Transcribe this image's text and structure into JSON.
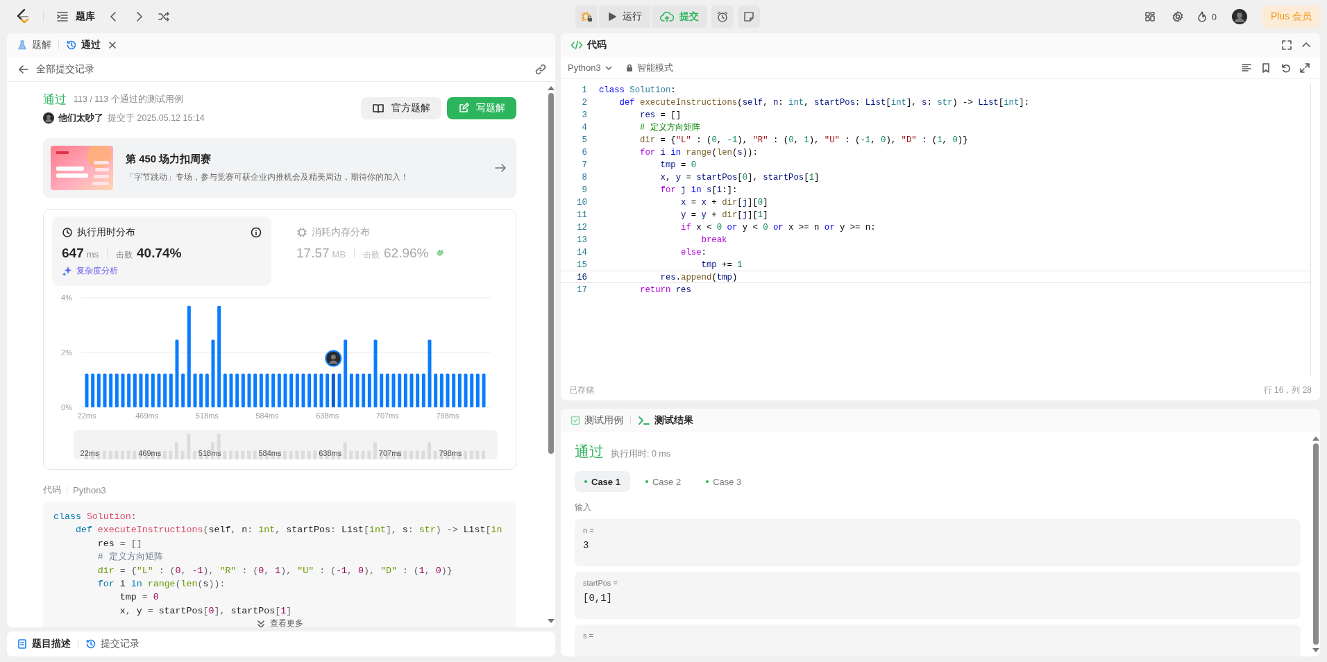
{
  "top_bar": {
    "problem_list": "题库",
    "run": "运行",
    "submit": "提交",
    "streak": "0",
    "plus": "Plus 会员"
  },
  "left_panel": {
    "tabs": [
      {
        "label": "题解",
        "selected": false,
        "closable": false
      },
      {
        "label": "通过",
        "selected": true,
        "closable": true
      }
    ],
    "back_link": "全部提交记录",
    "result": {
      "status": "通过",
      "passed": "113 / 113 个通过的测试用例",
      "user": "他们太吵了",
      "submitted": "提交于 2025.05.12 15:14"
    },
    "buttons": [
      {
        "label": "官方题解",
        "kind": "secondary"
      },
      {
        "label": "写题解",
        "kind": "primary"
      }
    ],
    "banner": {
      "title": "第 450 场力扣周赛",
      "description": "「字节跳动」专场，参与竞赛可获企业内推机会及精美周边，期待你的加入！"
    },
    "stats": [
      {
        "kind": "runtime",
        "title": "执行用时分布",
        "value": "647",
        "unit": "ms",
        "beats_label": "击败",
        "beats": "40.74%",
        "link": "复杂度分析",
        "selected": true
      },
      {
        "kind": "memory",
        "title": "消耗内存分布",
        "value": "17.57",
        "unit": "MB",
        "beats_label": "击败",
        "beats": "62.96%",
        "selected": false
      }
    ],
    "chart_data": {
      "type": "bar",
      "ylim": [
        0,
        4
      ],
      "yticks": [
        {
          "value": 0,
          "label": "0%"
        },
        {
          "value": 2,
          "label": "2%"
        },
        {
          "value": 4,
          "label": "4%"
        }
      ],
      "categories": [
        "22ms",
        null,
        null,
        null,
        null,
        null,
        null,
        null,
        null,
        null,
        "469ms",
        null,
        null,
        null,
        null,
        null,
        null,
        null,
        null,
        null,
        "518ms",
        null,
        null,
        null,
        null,
        null,
        null,
        null,
        null,
        null,
        "584ms",
        null,
        null,
        null,
        null,
        null,
        null,
        null,
        null,
        null,
        "638ms",
        null,
        null,
        null,
        null,
        null,
        null,
        null,
        null,
        null,
        "707ms",
        null,
        null,
        null,
        null,
        null,
        null,
        null,
        null,
        null,
        "798ms",
        null,
        null,
        null,
        null,
        null,
        null
      ],
      "series": [
        {
          "color": "#0a7cff",
          "values": [
            1.23,
            1.23,
            1.23,
            1.23,
            1.23,
            1.23,
            1.23,
            1.23,
            1.23,
            1.23,
            1.23,
            1.23,
            1.23,
            1.23,
            1.23,
            2.47,
            1.23,
            3.7,
            1.23,
            1.23,
            1.23,
            2.47,
            3.7,
            1.23,
            1.23,
            1.23,
            1.23,
            1.23,
            1.23,
            1.23,
            1.23,
            1.23,
            1.23,
            1.23,
            1.23,
            1.23,
            1.23,
            1.23,
            1.23,
            1.23,
            1.23,
            null,
            1.23,
            2.47,
            1.23,
            1.23,
            1.23,
            1.23,
            2.47,
            1.23,
            1.23,
            1.23,
            1.23,
            1.23,
            1.23,
            1.23,
            1.23,
            2.47,
            1.23,
            1.23,
            1.23,
            1.23,
            1.23,
            1.23,
            1.23,
            1.23,
            1.23
          ]
        },
        {
          "color": "#0a5fd0",
          "values": [
            null,
            null,
            null,
            null,
            null,
            null,
            null,
            null,
            null,
            null,
            null,
            null,
            null,
            null,
            null,
            null,
            null,
            null,
            null,
            null,
            null,
            null,
            null,
            null,
            null,
            null,
            null,
            null,
            null,
            null,
            null,
            null,
            null,
            null,
            null,
            null,
            null,
            null,
            null,
            null,
            null,
            1.23,
            null,
            null,
            null,
            null,
            null,
            null,
            null,
            null,
            null,
            null,
            null,
            null,
            null,
            null,
            null,
            null,
            null,
            null,
            null,
            null,
            null,
            null,
            null,
            null,
            null
          ]
        }
      ]
    },
    "overview_labels": [
      "22ms",
      "469ms",
      "518ms",
      "584ms",
      "638ms",
      "707ms",
      "798ms"
    ],
    "code_label": "代码",
    "code_language": "Python3",
    "code_lines": [
      [
        {
          "kind": "decl",
          "text": "class "
        },
        {
          "kind": "cls",
          "text": "Solution"
        },
        {
          "kind": "punc",
          "text": ":"
        }
      ],
      [
        {
          "kind": "decl",
          "text": "    def "
        },
        {
          "kind": "fn",
          "text": "executeInstructions"
        },
        {
          "kind": "punc",
          "text": "("
        },
        {
          "kind": "var",
          "text": "self"
        },
        {
          "kind": "punc",
          "text": ", "
        },
        {
          "kind": "var",
          "text": "n"
        },
        {
          "kind": "punc",
          "text": ": "
        },
        {
          "kind": "type",
          "text": "int"
        },
        {
          "kind": "punc",
          "text": ", "
        },
        {
          "kind": "var",
          "text": "startPos"
        },
        {
          "kind": "punc",
          "text": ": "
        },
        {
          "kind": "var",
          "text": "List"
        },
        {
          "kind": "punc",
          "text": "["
        },
        {
          "kind": "type",
          "text": "int"
        },
        {
          "kind": "punc",
          "text": "], "
        },
        {
          "kind": "var",
          "text": "s"
        },
        {
          "kind": "punc",
          "text": ": "
        },
        {
          "kind": "type",
          "text": "str"
        },
        {
          "kind": "punc",
          "text": ") -> "
        },
        {
          "kind": "var",
          "text": "List"
        },
        {
          "kind": "punc",
          "text": "["
        },
        {
          "kind": "type",
          "text": "in"
        }
      ],
      [
        {
          "kind": "var",
          "text": "        res"
        },
        {
          "kind": "punc",
          "text": " = []"
        }
      ],
      [
        {
          "kind": "cm",
          "text": "        # 定义方向矩阵"
        }
      ],
      [
        {
          "kind": "call",
          "text": "        dir"
        },
        {
          "kind": "punc",
          "text": " = {"
        },
        {
          "kind": "str",
          "text": "\"L\""
        },
        {
          "kind": "punc",
          "text": " : ("
        },
        {
          "kind": "num",
          "text": "0"
        },
        {
          "kind": "punc",
          "text": ", "
        },
        {
          "kind": "num",
          "text": "-1"
        },
        {
          "kind": "punc",
          "text": "), "
        },
        {
          "kind": "str",
          "text": "\"R\""
        },
        {
          "kind": "punc",
          "text": " : ("
        },
        {
          "kind": "num",
          "text": "0"
        },
        {
          "kind": "punc",
          "text": ", "
        },
        {
          "kind": "num",
          "text": "1"
        },
        {
          "kind": "punc",
          "text": "), "
        },
        {
          "kind": "str",
          "text": "\"U\""
        },
        {
          "kind": "punc",
          "text": " : ("
        },
        {
          "kind": "num",
          "text": "-1"
        },
        {
          "kind": "punc",
          "text": ", "
        },
        {
          "kind": "num",
          "text": "0"
        },
        {
          "kind": "punc",
          "text": "), "
        },
        {
          "kind": "str",
          "text": "\"D\""
        },
        {
          "kind": "punc",
          "text": " : ("
        },
        {
          "kind": "num",
          "text": "1"
        },
        {
          "kind": "punc",
          "text": ", "
        },
        {
          "kind": "num",
          "text": "0"
        },
        {
          "kind": "punc",
          "text": ")}"
        }
      ],
      [
        {
          "kind": "ctl",
          "text": "        for "
        },
        {
          "kind": "var",
          "text": "i "
        },
        {
          "kind": "op",
          "text": "in "
        },
        {
          "kind": "call",
          "text": "range"
        },
        {
          "kind": "punc",
          "text": "("
        },
        {
          "kind": "call",
          "text": "len"
        },
        {
          "kind": "punc",
          "text": "("
        },
        {
          "kind": "var",
          "text": "s"
        },
        {
          "kind": "punc",
          "text": ")):"
        }
      ],
      [
        {
          "kind": "var",
          "text": "            tmp"
        },
        {
          "kind": "punc",
          "text": " = "
        },
        {
          "kind": "num",
          "text": "0"
        }
      ],
      [
        {
          "kind": "var",
          "text": "            x"
        },
        {
          "kind": "punc",
          "text": ", "
        },
        {
          "kind": "var",
          "text": "y"
        },
        {
          "kind": "punc",
          "text": " = "
        },
        {
          "kind": "var",
          "text": "startPos"
        },
        {
          "kind": "punc",
          "text": "["
        },
        {
          "kind": "num",
          "text": "0"
        },
        {
          "kind": "punc",
          "text": "], "
        },
        {
          "kind": "var",
          "text": "startPos"
        },
        {
          "kind": "punc",
          "text": "["
        },
        {
          "kind": "num",
          "text": "1"
        },
        {
          "kind": "punc",
          "text": "]"
        }
      ]
    ],
    "more": "查看更多"
  },
  "bottom_tabs": [
    {
      "label": "题目描述",
      "selected": true
    },
    {
      "label": "提交记录",
      "selected": false
    }
  ],
  "editor": {
    "title": "代码",
    "language": "Python3",
    "mode": "智能模式",
    "saved": "已存储",
    "cursor": "行 16，列 28",
    "lines": [
      {
        "number": "1",
        "current": false,
        "tokens": [
          {
            "kind": "decl",
            "text": "class "
          },
          {
            "kind": "cls",
            "text": "Solution"
          },
          {
            "kind": "punc",
            "text": ":"
          }
        ]
      },
      {
        "number": "2",
        "current": false,
        "tokens": [
          {
            "kind": "decl",
            "text": "    def "
          },
          {
            "kind": "fn",
            "text": "executeInstructions"
          },
          {
            "kind": "punc",
            "text": "("
          },
          {
            "kind": "var",
            "text": "self"
          },
          {
            "kind": "punc",
            "text": ", "
          },
          {
            "kind": "var",
            "text": "n"
          },
          {
            "kind": "punc",
            "text": ": "
          },
          {
            "kind": "type",
            "text": "int"
          },
          {
            "kind": "punc",
            "text": ", "
          },
          {
            "kind": "var",
            "text": "startPos"
          },
          {
            "kind": "punc",
            "text": ": "
          },
          {
            "kind": "var",
            "text": "List"
          },
          {
            "kind": "punc",
            "text": "["
          },
          {
            "kind": "type",
            "text": "int"
          },
          {
            "kind": "punc",
            "text": "], "
          },
          {
            "kind": "var",
            "text": "s"
          },
          {
            "kind": "punc",
            "text": ": "
          },
          {
            "kind": "type",
            "text": "str"
          },
          {
            "kind": "punc",
            "text": ") -> "
          },
          {
            "kind": "var",
            "text": "List"
          },
          {
            "kind": "punc",
            "text": "["
          },
          {
            "kind": "type",
            "text": "int"
          },
          {
            "kind": "punc",
            "text": "]:"
          }
        ]
      },
      {
        "number": "3",
        "current": false,
        "tokens": [
          {
            "kind": "var",
            "text": "        res"
          },
          {
            "kind": "punc",
            "text": " = []"
          }
        ]
      },
      {
        "number": "4",
        "current": false,
        "tokens": [
          {
            "kind": "cm",
            "text": "        # 定义方向矩阵"
          }
        ]
      },
      {
        "number": "5",
        "current": false,
        "tokens": [
          {
            "kind": "call",
            "text": "        dir"
          },
          {
            "kind": "punc",
            "text": " = {"
          },
          {
            "kind": "str",
            "text": "\"L\""
          },
          {
            "kind": "punc",
            "text": " : ("
          },
          {
            "kind": "num",
            "text": "0"
          },
          {
            "kind": "punc",
            "text": ", "
          },
          {
            "kind": "num",
            "text": "-1"
          },
          {
            "kind": "punc",
            "text": "), "
          },
          {
            "kind": "str",
            "text": "\"R\""
          },
          {
            "kind": "punc",
            "text": " : ("
          },
          {
            "kind": "num",
            "text": "0"
          },
          {
            "kind": "punc",
            "text": ", "
          },
          {
            "kind": "num",
            "text": "1"
          },
          {
            "kind": "punc",
            "text": "), "
          },
          {
            "kind": "str",
            "text": "\"U\""
          },
          {
            "kind": "punc",
            "text": " : ("
          },
          {
            "kind": "num",
            "text": "-1"
          },
          {
            "kind": "punc",
            "text": ", "
          },
          {
            "kind": "num",
            "text": "0"
          },
          {
            "kind": "punc",
            "text": "), "
          },
          {
            "kind": "str",
            "text": "\"D\""
          },
          {
            "kind": "punc",
            "text": " : ("
          },
          {
            "kind": "num",
            "text": "1"
          },
          {
            "kind": "punc",
            "text": ", "
          },
          {
            "kind": "num",
            "text": "0"
          },
          {
            "kind": "punc",
            "text": ")}"
          }
        ]
      },
      {
        "number": "6",
        "current": false,
        "tokens": [
          {
            "kind": "ctl",
            "text": "        for "
          },
          {
            "kind": "var",
            "text": "i "
          },
          {
            "kind": "op",
            "text": "in "
          },
          {
            "kind": "call",
            "text": "range"
          },
          {
            "kind": "punc",
            "text": "("
          },
          {
            "kind": "call",
            "text": "len"
          },
          {
            "kind": "punc",
            "text": "("
          },
          {
            "kind": "var",
            "text": "s"
          },
          {
            "kind": "punc",
            "text": ")):"
          }
        ]
      },
      {
        "number": "7",
        "current": false,
        "tokens": [
          {
            "kind": "var",
            "text": "            tmp"
          },
          {
            "kind": "punc",
            "text": " = "
          },
          {
            "kind": "num",
            "text": "0"
          }
        ]
      },
      {
        "number": "8",
        "current": false,
        "tokens": [
          {
            "kind": "var",
            "text": "            x"
          },
          {
            "kind": "punc",
            "text": ", "
          },
          {
            "kind": "var",
            "text": "y"
          },
          {
            "kind": "punc",
            "text": " = "
          },
          {
            "kind": "var",
            "text": "startPos"
          },
          {
            "kind": "punc",
            "text": "["
          },
          {
            "kind": "num",
            "text": "0"
          },
          {
            "kind": "punc",
            "text": "], "
          },
          {
            "kind": "var",
            "text": "startPos"
          },
          {
            "kind": "punc",
            "text": "["
          },
          {
            "kind": "num",
            "text": "1"
          },
          {
            "kind": "punc",
            "text": "]"
          }
        ]
      },
      {
        "number": "9",
        "current": false,
        "tokens": [
          {
            "kind": "ctl",
            "text": "            for "
          },
          {
            "kind": "var",
            "text": "j "
          },
          {
            "kind": "op",
            "text": "in "
          },
          {
            "kind": "var",
            "text": "s"
          },
          {
            "kind": "punc",
            "text": "["
          },
          {
            "kind": "var",
            "text": "i"
          },
          {
            "kind": "punc",
            "text": ":]:"
          }
        ]
      },
      {
        "number": "10",
        "current": false,
        "tokens": [
          {
            "kind": "var",
            "text": "                x"
          },
          {
            "kind": "punc",
            "text": " = "
          },
          {
            "kind": "var",
            "text": "x"
          },
          {
            "kind": "punc",
            "text": " + "
          },
          {
            "kind": "call",
            "text": "dir"
          },
          {
            "kind": "punc",
            "text": "["
          },
          {
            "kind": "var",
            "text": "j"
          },
          {
            "kind": "punc",
            "text": "]["
          },
          {
            "kind": "num",
            "text": "0"
          },
          {
            "kind": "punc",
            "text": "]"
          }
        ]
      },
      {
        "number": "11",
        "current": false,
        "tokens": [
          {
            "kind": "var",
            "text": "                y"
          },
          {
            "kind": "punc",
            "text": " = "
          },
          {
            "kind": "var",
            "text": "y"
          },
          {
            "kind": "punc",
            "text": " + "
          },
          {
            "kind": "call",
            "text": "dir"
          },
          {
            "kind": "punc",
            "text": "["
          },
          {
            "kind": "var",
            "text": "j"
          },
          {
            "kind": "punc",
            "text": "]["
          },
          {
            "kind": "num",
            "text": "1"
          },
          {
            "kind": "punc",
            "text": "]"
          }
        ]
      },
      {
        "number": "12",
        "current": false,
        "tokens": [
          {
            "kind": "ctl",
            "text": "                if"
          },
          {
            "kind": "punc",
            "text": " x < "
          },
          {
            "kind": "num",
            "text": "0"
          },
          {
            "kind": "op",
            "text": " or"
          },
          {
            "kind": "punc",
            "text": " y < "
          },
          {
            "kind": "num",
            "text": "0"
          },
          {
            "kind": "op",
            "text": " or"
          },
          {
            "kind": "punc",
            "text": " x >= n "
          },
          {
            "kind": "op",
            "text": "or"
          },
          {
            "kind": "punc",
            "text": " y >= n:"
          }
        ]
      },
      {
        "number": "13",
        "current": false,
        "tokens": [
          {
            "kind": "ctl",
            "text": "                    break"
          }
        ]
      },
      {
        "number": "14",
        "current": false,
        "tokens": [
          {
            "kind": "ctl",
            "text": "                else"
          },
          {
            "kind": "punc",
            "text": ":"
          }
        ]
      },
      {
        "number": "15",
        "current": false,
        "tokens": [
          {
            "kind": "var",
            "text": "                    tmp"
          },
          {
            "kind": "punc",
            "text": " += "
          },
          {
            "kind": "num",
            "text": "1"
          }
        ]
      },
      {
        "number": "16",
        "current": true,
        "tokens": [
          {
            "kind": "var",
            "text": "            res"
          },
          {
            "kind": "punc",
            "text": "."
          },
          {
            "kind": "call",
            "text": "append"
          },
          {
            "kind": "punc",
            "text": "("
          },
          {
            "kind": "var",
            "text": "tmp"
          },
          {
            "kind": "punc",
            "text": ")"
          }
        ]
      },
      {
        "number": "17",
        "current": false,
        "tokens": [
          {
            "kind": "ctl",
            "text": "        return "
          },
          {
            "kind": "var",
            "text": "res"
          }
        ]
      }
    ]
  },
  "test_panel": {
    "tabs": [
      {
        "label": "测试用例",
        "selected": false
      },
      {
        "label": "测试结果",
        "selected": true
      }
    ],
    "status": "通过",
    "runtime": "执行用时: 0 ms",
    "cases": [
      {
        "label": "Case 1",
        "selected": true
      },
      {
        "label": "Case 2",
        "selected": false
      },
      {
        "label": "Case 3",
        "selected": false
      }
    ],
    "input_label": "输入",
    "inputs": [
      {
        "name": "n =",
        "value": "3"
      },
      {
        "name": "startPos =",
        "value": "[0,1]"
      },
      {
        "name": "s ="
      }
    ]
  }
}
